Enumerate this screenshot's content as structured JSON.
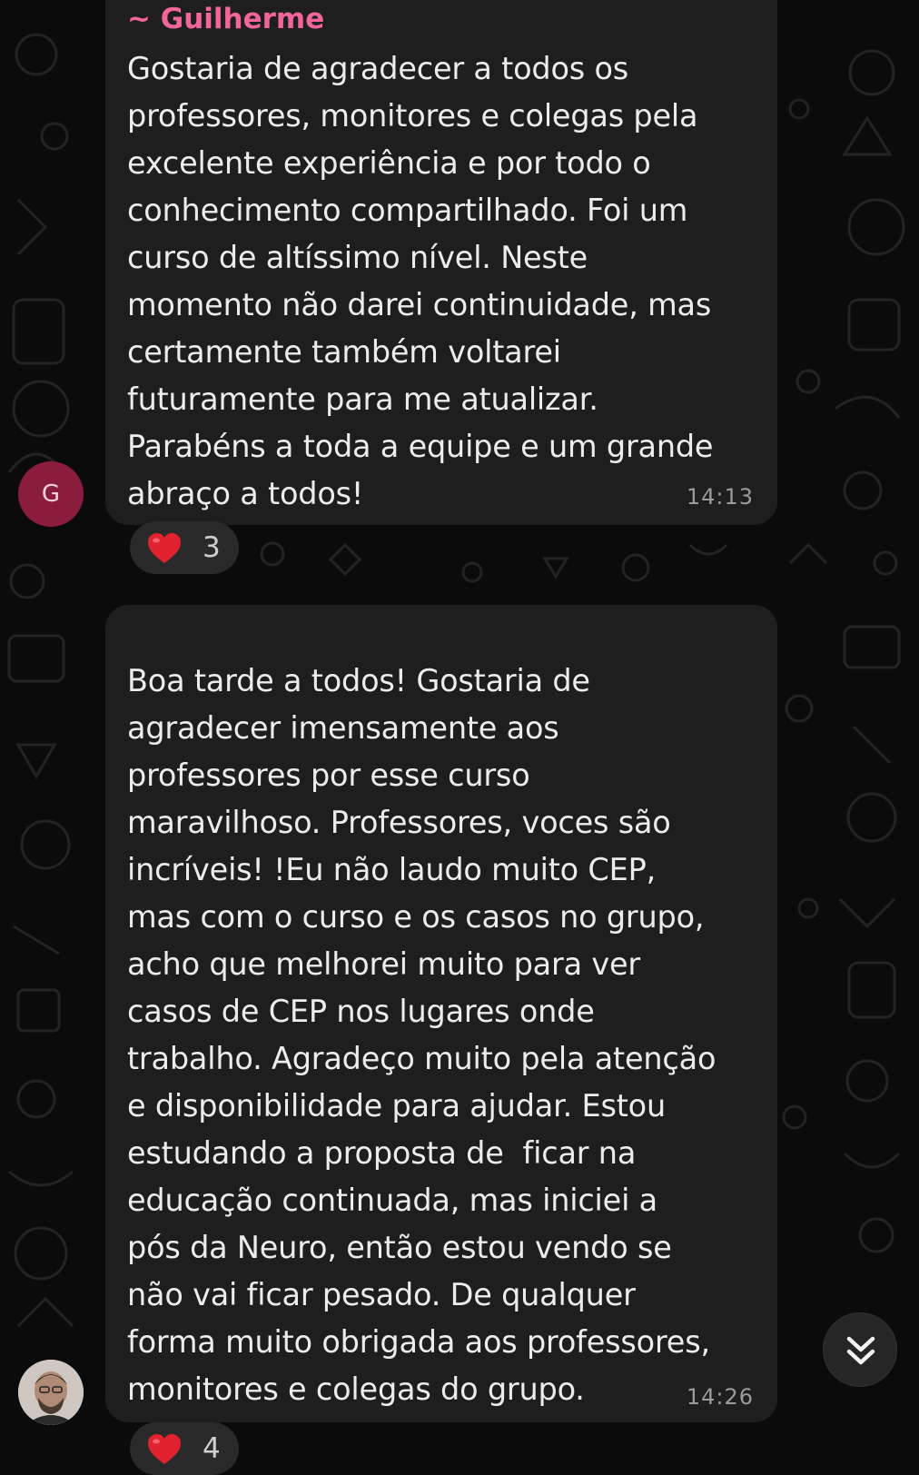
{
  "chat": {
    "messages": [
      {
        "sender": "~ Guilherme",
        "avatar_letter": "G",
        "lines": [
          "Gostaria de agradecer a todos os",
          "professores, monitores e colegas pela",
          "excelente experiência e por todo o",
          "conhecimento compartilhado. Foi um",
          "curso de altíssimo nível. Neste",
          "momento não darei continuidade, mas",
          "certamente também voltarei",
          "futuramente para me atualizar.",
          "Parabéns a toda a equipe e um grande",
          "abraço a todos!"
        ],
        "time": "14:13",
        "reaction": {
          "emoji_icon": "red-heart-icon",
          "count": "3"
        }
      },
      {
        "lines": [
          "Boa tarde a todos! Gostaria de",
          "agradecer imensamente aos",
          "professores por esse curso",
          "maravilhoso. Professores, voces são",
          "incríveis! !Eu não laudo muito CEP,",
          "mas com o curso e os casos no grupo,",
          "acho que melhorei muito para ver",
          "casos de CEP nos lugares onde",
          "trabalho. Agradeço muito pela atenção",
          "e disponibilidade para ajudar. Estou",
          "estudando a proposta de  ficar na",
          "educação continuada, mas iniciei a",
          "pós da Neuro, então estou vendo se",
          "não vai ficar pesado. De qualquer",
          "forma muito obrigada aos professores,",
          "monitores e colegas do grupo."
        ],
        "time": "14:26",
        "reaction": {
          "emoji_icon": "red-heart-icon",
          "count": "4"
        }
      }
    ],
    "scroll_button_icon": "double-chevron-down-icon"
  },
  "colors": {
    "background": "#0b0b0b",
    "bubble": "#1e1e1e",
    "sender_name": "#f0659a",
    "text": "#ececec",
    "time": "#9b9b9b",
    "avatar_g": "#8b1d3c",
    "heart": "#e0232e"
  }
}
